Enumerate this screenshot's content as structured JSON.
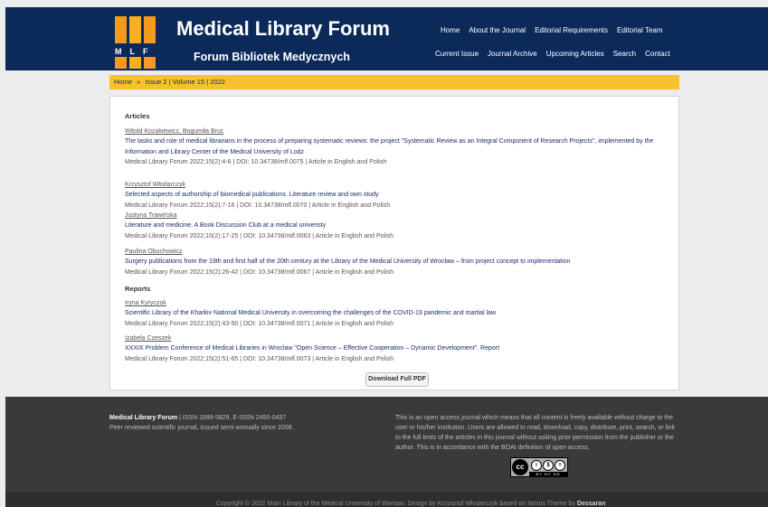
{
  "header": {
    "logo_letters": "MLF",
    "title": "Medical Library Forum",
    "subtitle": "Forum Bibliotek Medycznych",
    "nav_row1": [
      "Home",
      "About the Journal",
      "Editorial Requirements",
      "Editorial Team"
    ],
    "nav_row2": [
      "Current Issue",
      "Journal Archive",
      "Upcoming Articles",
      "Search",
      "Contact"
    ]
  },
  "breadcrumb": {
    "home": "Home",
    "separator": "»",
    "current": "Issue 2 | Volume 15 | 2022"
  },
  "content": {
    "articles_heading": "Articles",
    "reports_heading": "Reports",
    "articles": [
      {
        "authors": [
          "Witold Kozakiewicz",
          "Bogumiła Bruc"
        ],
        "title": "The tasks and role of medical librarians in the process of preparing systematic reviews: the project \"Systematic Review as an Integral Component of Research Projects\", implemented by the Information and Library Center of the Medical University of Lodz",
        "meta": "Medical Library Forum 2022;15(2):4-6 | DOI: 10.34738/mlf.0075 | Article in English and Polish"
      },
      {
        "authors": [
          "Krzysztof Włodarczyk"
        ],
        "title": "Selected aspects of authorship of biomedical publications. Literature review and own study",
        "meta": "Medical Library Forum 2022;15(2):7-16 | DOI: 10.34738/mlf.0070 | Article in English and Polish"
      },
      {
        "authors": [
          "Justyna Trawińska"
        ],
        "title": "Literature and medicine. A Book Discussion Club at a medical univeristy",
        "meta": "Medical Library Forum 2022;15(2):17-25 | DOI: 10.34738/mlf.0063 | Article in English and Polish"
      },
      {
        "authors": [
          "Paulina Obuchowicz"
        ],
        "title": "Surgery publications from the 19th and first half of the 20th century at the Library of the Medical University of Wrocław – from project concept to implementation",
        "meta": "Medical Library Forum 2022;15(2):26-42 | DOI: 10.34738/mlf.0067 | Article in English and Polish"
      }
    ],
    "reports": [
      {
        "authors": [
          "Iryna Kyryczok"
        ],
        "title": "Scientific Library of the Kharkiv National Medical University in overcoming the challenges of the COVID-19 pandemic and martial law",
        "meta": "Medical Library Forum 2022;15(2):43-50 | DOI: 10.34738/mlf.0071 | Article in English and Polish"
      },
      {
        "authors": [
          "Izabela Czeszek"
        ],
        "title": "XXXIX Problem Conference of Medical Libraries in Wroclaw \"Open Science – Effective Cooperation – Dynamic Development\". Report",
        "meta": "Medical Library Forum 2022;15(2):51-65 | DOI: 10.34738/mlf.0073 | Article in English and Polish"
      }
    ],
    "download_label": "Download Full PDF"
  },
  "footer": {
    "journal_name": "Medical Library Forum",
    "issn": " | ISSN 1899-5829, E-ISSN 2450-0437",
    "description": "Peer reviewed scientific journal, issued semi-annually since 2008.",
    "open_access": "This is an open access journal which means that all content is freely available without charge to the user or his/her institution. Users are allowed to read, download, copy, distribute, print, search, or link to the full texts of the articles in this journal without asking prior permission from the publisher or the author. This is in accordance with the BOAI definition of open access.",
    "license_badge_text": "BY NC ND",
    "copyright_text": "Copyright © 2022 Main Library of the Medical University of Warsaw. Design by Krzysztof Włodarczyk based on Nexus Theme by ",
    "copyright_link": "Dessaran"
  }
}
